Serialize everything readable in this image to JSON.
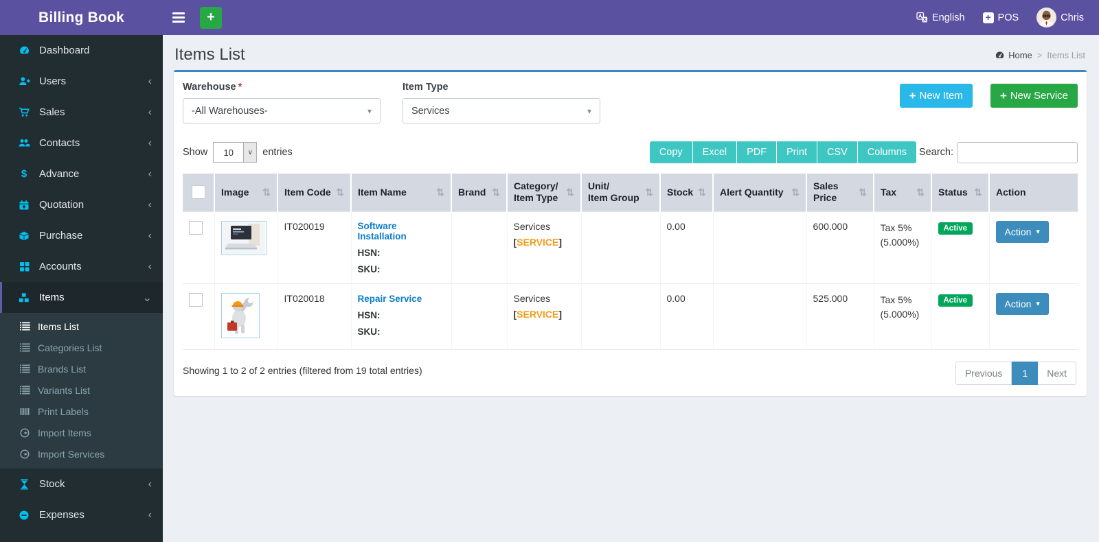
{
  "app": {
    "title": "Billing Book"
  },
  "topbar": {
    "language": "English",
    "pos_label": "POS",
    "username": "Chris"
  },
  "glyphs": {
    "chevron_left": "‹",
    "chevron_down": "⌄",
    "caret_down": "▾",
    "sort": "⇅",
    "breadcrumb_sep": ">",
    "plus": "+",
    "select_caret": "▾",
    "native_caret": "∨",
    "dollar": "$"
  },
  "sidebar": {
    "items": [
      {
        "label": "Dashboard"
      },
      {
        "label": "Users"
      },
      {
        "label": "Sales"
      },
      {
        "label": "Contacts"
      },
      {
        "label": "Advance"
      },
      {
        "label": "Quotation"
      },
      {
        "label": "Purchase"
      },
      {
        "label": "Accounts"
      },
      {
        "label": "Items"
      },
      {
        "label": "Stock"
      },
      {
        "label": "Expenses"
      }
    ],
    "items_submenu": [
      {
        "label": "Items List"
      },
      {
        "label": "Categories List"
      },
      {
        "label": "Brands List"
      },
      {
        "label": "Variants List"
      },
      {
        "label": "Print Labels"
      },
      {
        "label": "Import Items"
      },
      {
        "label": "Import Services"
      }
    ]
  },
  "page": {
    "title": "Items List",
    "breadcrumb_home": "Home",
    "breadcrumb_current": "Items List"
  },
  "filters": {
    "warehouse_label": "Warehouse",
    "required_mark": "*",
    "warehouse_value": "-All Warehouses-",
    "item_type_label": "Item Type",
    "item_type_value": "Services",
    "new_item_label": "New Item",
    "new_service_label": "New Service"
  },
  "controls": {
    "show_label": "Show",
    "page_length": "10",
    "entries_label": "entries",
    "search_label": "Search:",
    "search_value": "",
    "export_buttons": [
      "Copy",
      "Excel",
      "PDF",
      "Print",
      "CSV",
      "Columns"
    ]
  },
  "table": {
    "headers": [
      "",
      "Image",
      "Item Code",
      "Item Name",
      "Brand",
      "Category/\nItem Type",
      "Unit/\nItem Group",
      "Stock",
      "Alert Quantity",
      "Sales Price",
      "Tax",
      "Status",
      "Action"
    ],
    "rows": [
      {
        "item_code": "IT020019",
        "item_name": "Software Installation",
        "hsn_label": "HSN:",
        "sku_label": "SKU:",
        "category": "Services",
        "bracket_open": "[",
        "type_tag": "SERVICE",
        "bracket_close": "]",
        "stock": "0.00",
        "sales_price": "600.000",
        "tax": "Tax 5%\n(5.000%)",
        "status": "Active",
        "action_label": "Action"
      },
      {
        "item_code": "IT020018",
        "item_name": "Repair Service",
        "hsn_label": "HSN:",
        "sku_label": "SKU:",
        "category": "Services",
        "bracket_open": "[",
        "type_tag": "SERVICE",
        "bracket_close": "]",
        "stock": "0.00",
        "sales_price": "525.000",
        "tax": "Tax 5%\n(5.000%)",
        "status": "Active",
        "action_label": "Action"
      }
    ]
  },
  "footer": {
    "info": "Showing 1 to 2 of 2 entries (filtered from 19 total entries)",
    "previous_label": "Previous",
    "page_number": "1",
    "next_label": "Next"
  },
  "colors": {
    "topbar_purple": "#5a51a0",
    "sidebar_dark": "#222d32",
    "submenu_dark": "#2c3b41",
    "active_purple": "#605ca8",
    "icon_cyan": "#00c0ef",
    "accent_blue": "#3c8dbc",
    "export_teal": "#3dc6c2",
    "new_item_aqua": "#29b8e8",
    "button_green": "#28a745",
    "badge_green": "#00a65a",
    "link_blue": "#0a7cc9",
    "tag_orange": "#f39c12",
    "content_bg": "#ecf0f5",
    "table_header_bg": "#d4d8e0"
  }
}
